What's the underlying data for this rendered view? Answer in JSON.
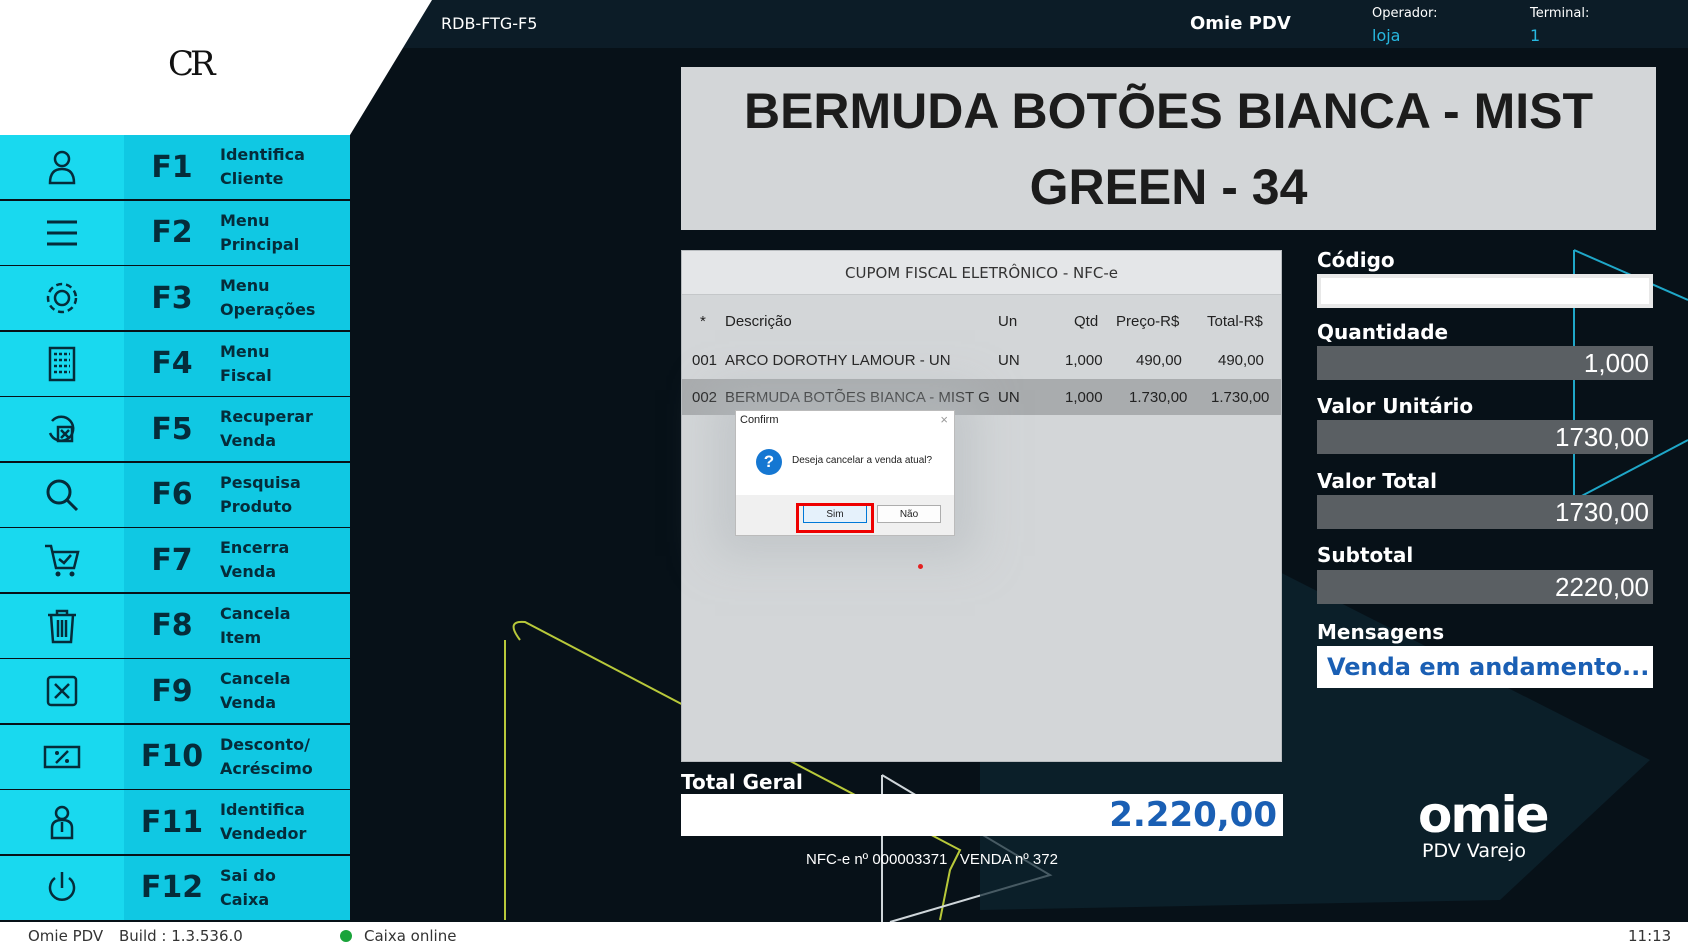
{
  "header": {
    "logo_text": "CR",
    "doc_code": "RDB-FTG-F5",
    "app_name": "Omie PDV",
    "operator_label": "Operador:",
    "operator_value": "loja",
    "terminal_label": "Terminal:",
    "terminal_value": "1"
  },
  "sidebar": {
    "items": [
      {
        "key": "F1",
        "label": "Identifica\nCliente",
        "icon": "user-icon"
      },
      {
        "key": "F2",
        "label": "Menu\nPrincipal",
        "icon": "menu-icon"
      },
      {
        "key": "F3",
        "label": "Menu\nOperações",
        "icon": "gear-icon"
      },
      {
        "key": "F4",
        "label": "Menu\nFiscal",
        "icon": "calculator-icon"
      },
      {
        "key": "F5",
        "label": "Recuperar\nVenda",
        "icon": "recover-sale-icon"
      },
      {
        "key": "F6",
        "label": "Pesquisa\nProduto",
        "icon": "search-icon"
      },
      {
        "key": "F7",
        "label": "Encerra\nVenda",
        "icon": "cart-check-icon"
      },
      {
        "key": "F8",
        "label": "Cancela\nItem",
        "icon": "trash-icon"
      },
      {
        "key": "F9",
        "label": "Cancela\nVenda",
        "icon": "cancel-box-icon"
      },
      {
        "key": "F10",
        "label": "Desconto/\nAcréscimo",
        "icon": "discount-icon"
      },
      {
        "key": "F11",
        "label": "Identifica\nVendedor",
        "icon": "seller-icon"
      },
      {
        "key": "F12",
        "label": "Sai do\nCaixa",
        "icon": "power-icon"
      }
    ]
  },
  "product": {
    "title": "BERMUDA BOTÕES BIANCA - MIST GREEN - 34"
  },
  "receipt": {
    "header": "CUPOM FISCAL ELETRÔNICO - NFC-e",
    "columns": {
      "star": "*",
      "desc": "Descrição",
      "un": "Un",
      "qtd": "Qtd",
      "preco": "Preço-R$",
      "total": "Total-R$"
    },
    "rows": [
      {
        "num": "001",
        "desc": "ARCO DOROTHY LAMOUR - UN",
        "un": "UN",
        "qtd": "1,000",
        "preco": "490,00",
        "total": "490,00"
      },
      {
        "num": "002",
        "desc": "BERMUDA BOTÕES BIANCA - MIST G",
        "un": "UN",
        "qtd": "1,000",
        "preco": "1.730,00",
        "total": "1.730,00"
      }
    ]
  },
  "dialog": {
    "title": "Confirm",
    "close": "×",
    "message": "Deseja cancelar a venda atual?",
    "yes": "Sim",
    "no": "Não",
    "icon": "question-icon"
  },
  "totals": {
    "label": "Total Geral",
    "value": "2.220,00",
    "nfce_line": "NFC-e nº 000003371   VENDA nº 372"
  },
  "fields": {
    "codigo_label": "Código",
    "codigo_value": "",
    "quantidade_label": "Quantidade",
    "quantidade_value": "1,000",
    "valor_unitario_label": "Valor Unitário",
    "valor_unitario_value": "1730,00",
    "valor_total_label": "Valor Total",
    "valor_total_value": "1730,00",
    "subtotal_label": "Subtotal",
    "subtotal_value": "2220,00",
    "mensagens_label": "Mensagens",
    "mensagens_value": "Venda em andamento..."
  },
  "brand": {
    "logo": "omie",
    "sub": "PDV Varejo"
  },
  "status": {
    "app": "Omie PDV",
    "build": "Build : 1.3.536.0",
    "connection": "Caixa online",
    "time": "11:13"
  },
  "colors": {
    "sidebar_bg": "#10c8e3",
    "accent_blue": "#1a5fb4",
    "online_green": "#1aa33a",
    "highlight_red": "#e00000"
  }
}
